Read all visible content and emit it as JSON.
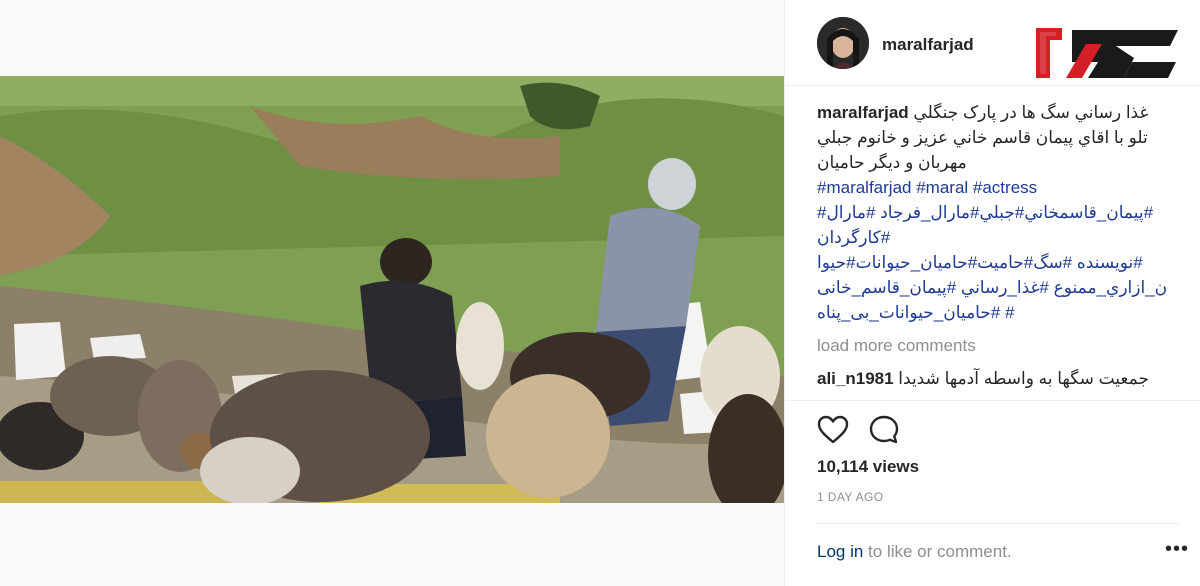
{
  "post": {
    "username": "maralfarjad",
    "caption_lines": [
      "غذا رساني سگ ها در پارک جنگلي",
      "تلو با اقاي پيمان قاسم خاني عزيز و خانوم جبلي",
      "مهربان و ديگر حاميان"
    ],
    "hashtag_lines": [
      "#maralfarjad #maral #actress",
      "#پیمان_قاسمخاني#جبلي#مارال_فرجاد #مارال#",
      "#کارگردان",
      "#نويسنده #سگ#حاميت#حاميان_حيوانات#حيوا",
      "ن_ازاري_ممنوع #غذا_رساني  #پیمان_قاسم_خانی",
      "# #حاميان_حيوانات_بی_پناه"
    ],
    "load_more_label": "load more comments",
    "comments": [
      {
        "user": "ali_n1981",
        "text": "جمعيت سگها به واسطه آدمها شديدا"
      }
    ],
    "views_label": "10,114 views",
    "time_label": "1 DAY AGO",
    "login_link": "Log in",
    "login_suffix": " to like or comment."
  },
  "icons": {
    "like": "heart-outline-icon",
    "comment": "speech-bubble-icon",
    "more": "more-options-icon"
  },
  "colors": {
    "hashtag": "#1f3a93",
    "muted": "#8e8e8e",
    "link": "#003569",
    "watermark_red": "#d51f26"
  }
}
